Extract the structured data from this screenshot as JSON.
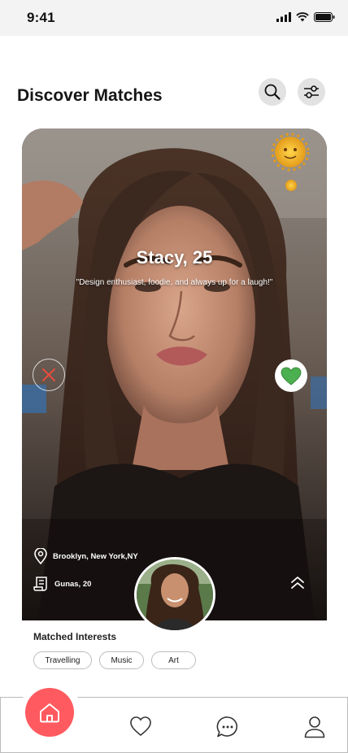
{
  "status_bar": {
    "time": "9:41",
    "signal_icon": "cellular-signal-icon",
    "wifi_icon": "wifi-icon",
    "battery_icon": "battery-icon"
  },
  "header": {
    "title": "Discover Matches",
    "search_icon": "search-icon",
    "filter_icon": "filter-sliders-icon"
  },
  "profile": {
    "name_age": "Stacy, 25",
    "bio": "\"Design enthusiast, foodie, and always up for a laugh!\"",
    "location": "Brooklyn, New York,NY",
    "match_label": "Gunas, 20",
    "location_icon": "location-pin-icon",
    "document_icon": "document-icon",
    "dislike_icon": "close-icon",
    "like_icon": "heart-icon",
    "expand_icon": "chevron-double-up-icon"
  },
  "interests": {
    "title": "Matched Interests",
    "items": [
      "Travelling",
      "Music",
      "Art"
    ]
  },
  "tab_bar": {
    "items": [
      {
        "name": "home",
        "icon": "home-icon",
        "active": true
      },
      {
        "name": "likes",
        "icon": "heart-icon",
        "active": false
      },
      {
        "name": "chat",
        "icon": "chat-bubble-icon",
        "active": false
      },
      {
        "name": "profile",
        "icon": "user-icon",
        "active": false
      }
    ]
  },
  "colors": {
    "accent": "#ff5a5f",
    "like": "#4caf50",
    "dislike": "#e74c3c"
  }
}
